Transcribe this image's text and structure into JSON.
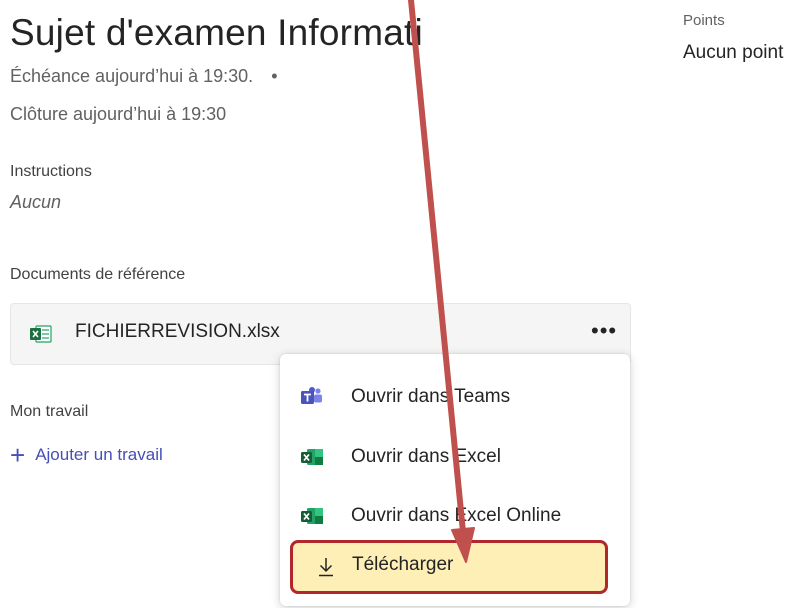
{
  "assignment": {
    "title": "Sujet d'examen Informati",
    "due": "Échéance aujourd’hui à 19:30.",
    "due_separator": "•",
    "closing": "Clôture aujourd’hui à 19:30"
  },
  "points": {
    "label": "Points",
    "value": "Aucun point"
  },
  "instructions": {
    "label": "Instructions",
    "value": "Aucun"
  },
  "references": {
    "label": "Documents de référence",
    "file": {
      "name": "FICHIERREVISION.xlsx",
      "icon": "excel-file-icon",
      "more_label": "•••"
    }
  },
  "my_work": {
    "label": "Mon travail",
    "add_label": "Ajouter un travail",
    "add_icon": "plus-icon"
  },
  "context_menu": {
    "items": [
      {
        "label": "Ouvrir dans Teams",
        "icon": "teams-icon"
      },
      {
        "label": "Ouvrir dans Excel",
        "icon": "excel-icon"
      },
      {
        "label": "Ouvrir dans Excel Online",
        "icon": "excel-icon"
      },
      {
        "label": "Télécharger",
        "icon": "download-icon"
      }
    ]
  },
  "colors": {
    "accent": "#464eb8",
    "excel_green": "#1d6f42",
    "teams_purple": "#5059c9",
    "highlight_fill": "#fdefb5",
    "highlight_border": "#b2282a",
    "annotation_arrow": "#c0504d"
  }
}
